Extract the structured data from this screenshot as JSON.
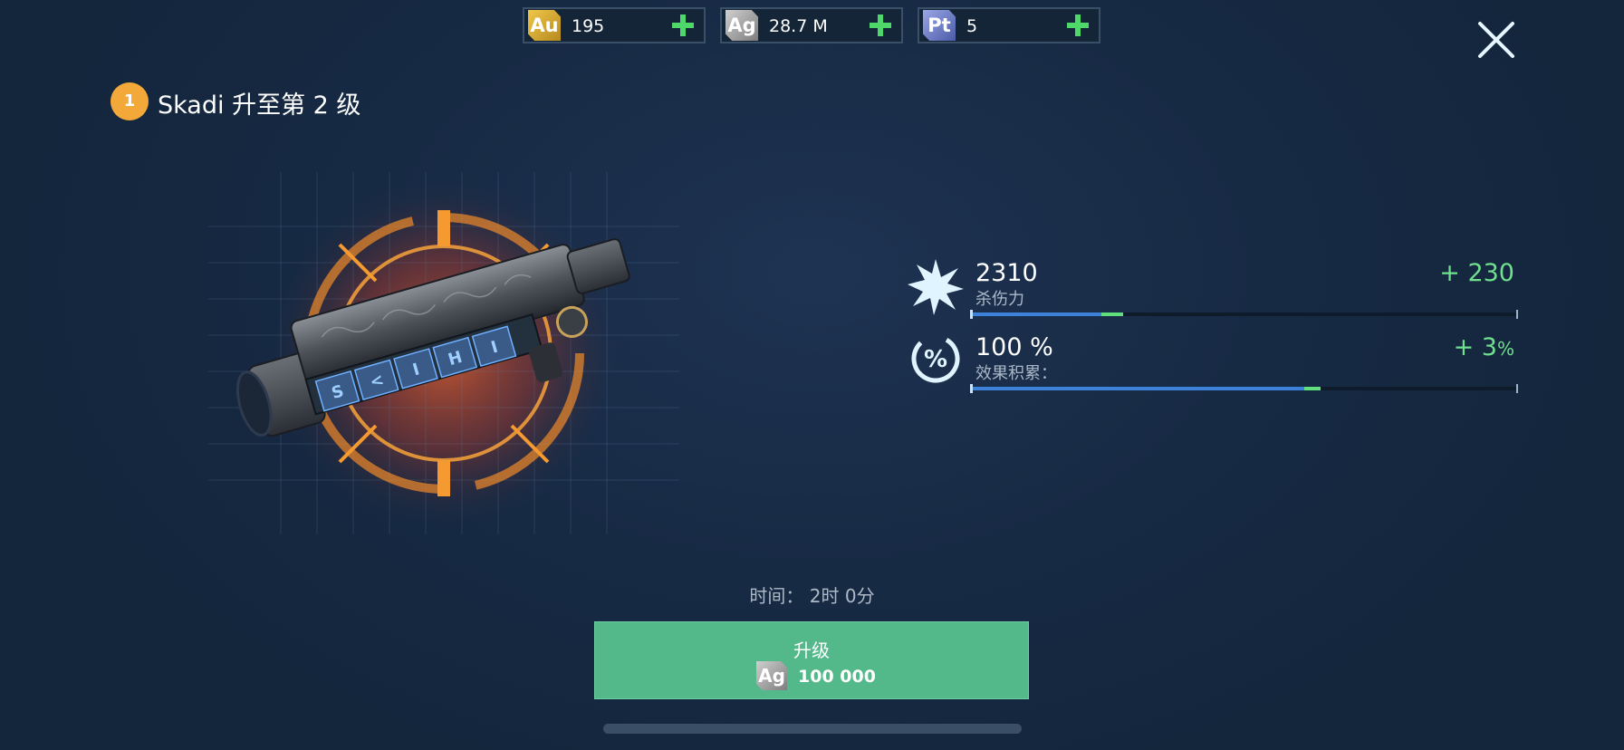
{
  "currency": [
    {
      "symbol": "Au",
      "value": "195",
      "color": "#e0b034"
    },
    {
      "symbol": "Ag",
      "value": "28.7 M",
      "color": "#a9a9a9"
    },
    {
      "symbol": "Pt",
      "value": "5",
      "color": "#6f7fc9"
    }
  ],
  "task": {
    "number": "1",
    "title": "Skadi 升至第 2 级"
  },
  "weapon": {
    "runes": [
      "S",
      "<",
      "I",
      "H",
      "I"
    ]
  },
  "stats": [
    {
      "value": "2310",
      "label": "杀伤力",
      "gain": "+ 230",
      "icon": "burst-icon",
      "fill": 0.24,
      "gain_fill": 0.04
    },
    {
      "value": "100 %",
      "label": "效果积累：",
      "gain_prefix": "+ 3",
      "gain_unit": "%",
      "icon": "percent-icon",
      "fill": 0.61,
      "gain_fill": 0.03
    }
  ],
  "upgrade": {
    "time_label": "时间： 2时 0分",
    "button_label": "升级",
    "cost_symbol": "Ag",
    "cost": "100 000"
  },
  "colors": {
    "accent_green": "#54b98a",
    "gain_green": "#6fe08e",
    "bar_blue": "#3b82d8",
    "badge_orange": "#f3a93a"
  }
}
